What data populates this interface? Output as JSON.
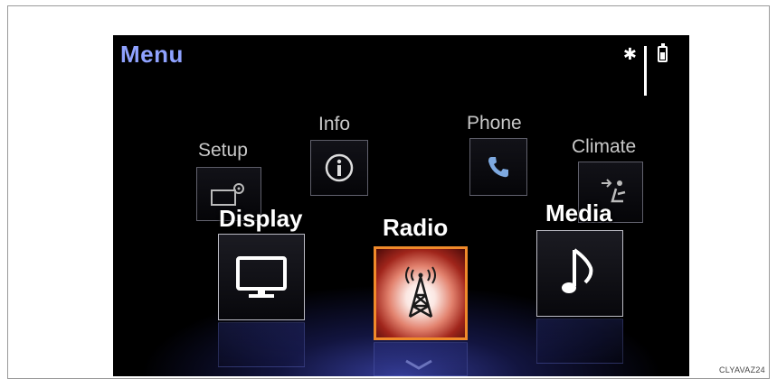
{
  "header": {
    "title": "Menu"
  },
  "status": {
    "bluetooth_icon": "bluetooth-icon",
    "signal_icon": "signal-bars-icon",
    "battery_icon": "battery-icon"
  },
  "menu": {
    "setup": "Setup",
    "info": "Info",
    "phone": "Phone",
    "climate": "Climate",
    "display": "Display",
    "radio": "Radio",
    "media": "Media"
  },
  "selected_item": "Radio",
  "colors": {
    "title": "#8fa2ff",
    "selection_border": "#f08a2a",
    "background": "#000000"
  },
  "figure_code": "CLYAVAZ24"
}
